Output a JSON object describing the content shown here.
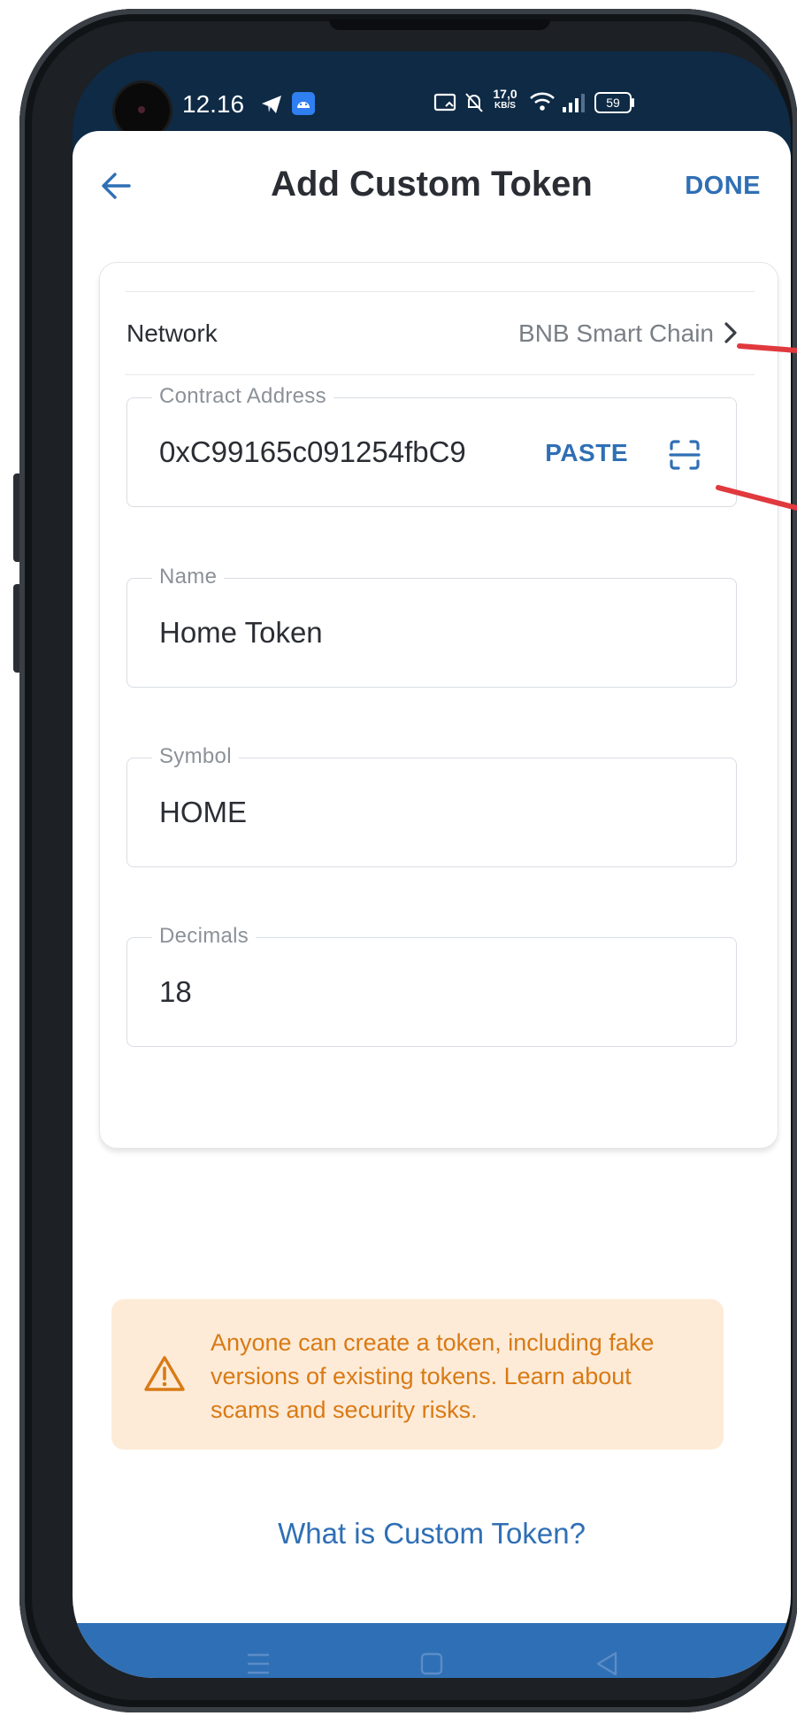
{
  "status_bar": {
    "time": "12.16",
    "network_speed": "17,0",
    "network_speed_unit": "KB/S",
    "battery": "59"
  },
  "header": {
    "title": "Add Custom Token",
    "done_label": "DONE"
  },
  "form": {
    "network": {
      "label": "Network",
      "value": "BNB Smart Chain"
    },
    "contract_address": {
      "label": "Contract Address",
      "value": "0xC99165c091254fbC9",
      "paste_label": "PASTE"
    },
    "name": {
      "label": "Name",
      "value": "Home Token"
    },
    "symbol": {
      "label": "Symbol",
      "value": "HOME"
    },
    "decimals": {
      "label": "Decimals",
      "value": "18"
    }
  },
  "warning": {
    "text": "Anyone can create a token, including fake versions of existing tokens. Learn about scams and security risks."
  },
  "help_link": {
    "label": "What is Custom Token?"
  },
  "colors": {
    "accent": "#2f6fb5",
    "warning_bg": "#fdebd8",
    "warning_text": "#d97a14",
    "annotation": "#e0393e"
  },
  "icons": {
    "back": "arrow-left-icon",
    "chevron": "chevron-right-icon",
    "scan": "scan-qr-icon",
    "warning": "warning-triangle-icon",
    "nav_menu": "menu-icon",
    "nav_home": "home-square-icon",
    "nav_back": "triangle-back-icon"
  }
}
